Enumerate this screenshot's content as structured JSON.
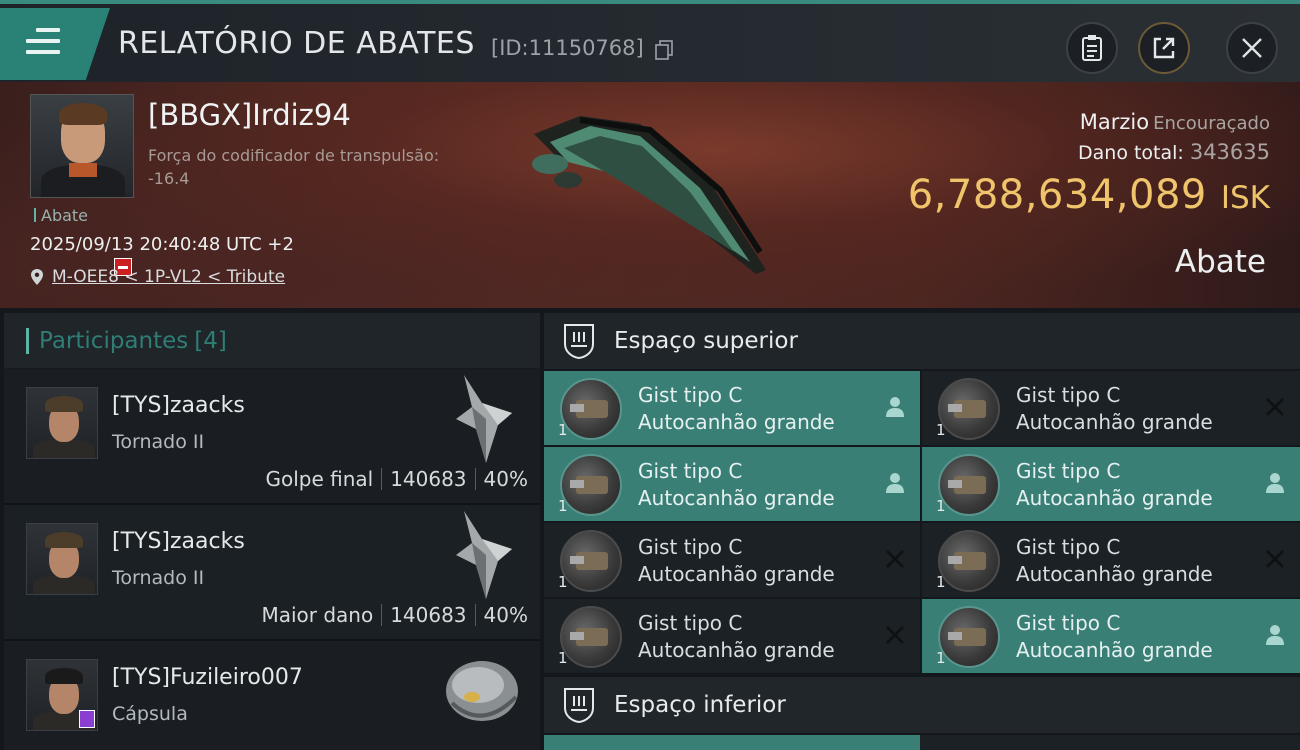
{
  "header": {
    "title": "RELATÓRIO DE ABATES",
    "report_id": "[ID:11150768]"
  },
  "victim": {
    "name": "[BBGX]Irdiz94",
    "warp_label": "Força do codificador de transpulsão:",
    "warp_value": "-16.4",
    "kill_tag": "Abate",
    "datetime": "2025/09/13 20:40:48 UTC +2",
    "location": "M-OEE8 < 1P-VL2 < Tribute",
    "ship_name": "Marzio",
    "ship_class": "Encouraçado",
    "damage_label": "Dano total:",
    "damage_value": "343635",
    "isk_value": "6,788,634,089",
    "isk_unit": "ISK",
    "kill_type": "Abate"
  },
  "participants": {
    "title": "Participantes",
    "count": "[4]",
    "rows": [
      {
        "name": "[TYS]zaacks",
        "ship": "Tornado II",
        "role": "Golpe final",
        "damage": "140683",
        "percent": "40%"
      },
      {
        "name": "[TYS]zaacks",
        "ship": "Tornado II",
        "role": "Maior dano",
        "damage": "140683",
        "percent": "40%"
      },
      {
        "name": "[TYS]Fuzileiro007",
        "ship": "Cápsula",
        "role": "",
        "damage": "",
        "percent": ""
      }
    ]
  },
  "slots": {
    "upper_title": "Espaço superior",
    "lower_title": "Espaço inferior",
    "upper": [
      {
        "name": "Gist tipo C",
        "type": "Autocanhão grande",
        "qty": "1",
        "state": "pilot",
        "active": true
      },
      {
        "name": "Gist tipo C",
        "type": "Autocanhão grande",
        "qty": "1",
        "state": "destroyed",
        "active": false
      },
      {
        "name": "Gist tipo C",
        "type": "Autocanhão grande",
        "qty": "1",
        "state": "pilot",
        "active": true
      },
      {
        "name": "Gist tipo C",
        "type": "Autocanhão grande",
        "qty": "1",
        "state": "pilot",
        "active": true
      },
      {
        "name": "Gist tipo C",
        "type": "Autocanhão grande",
        "qty": "1",
        "state": "destroyed",
        "active": false
      },
      {
        "name": "Gist tipo C",
        "type": "Autocanhão grande",
        "qty": "1",
        "state": "destroyed",
        "active": false
      },
      {
        "name": "Gist tipo C",
        "type": "Autocanhão grande",
        "qty": "1",
        "state": "destroyed",
        "active": false
      },
      {
        "name": "Gist tipo C",
        "type": "Autocanhão grande",
        "qty": "1",
        "state": "pilot",
        "active": true
      }
    ]
  },
  "colors": {
    "accent": "#3a7f76",
    "isk": "#f0c46b",
    "security_badge": "#cc1f1f"
  },
  "icons": {
    "menu": "menu-icon",
    "copy": "copy-icon",
    "clipboard": "clipboard-icon",
    "share": "share-icon",
    "close": "close-icon",
    "location": "location-pin-icon",
    "slot": "shield-slot-icon",
    "pilot": "person-icon",
    "destroyed": "x-icon"
  }
}
